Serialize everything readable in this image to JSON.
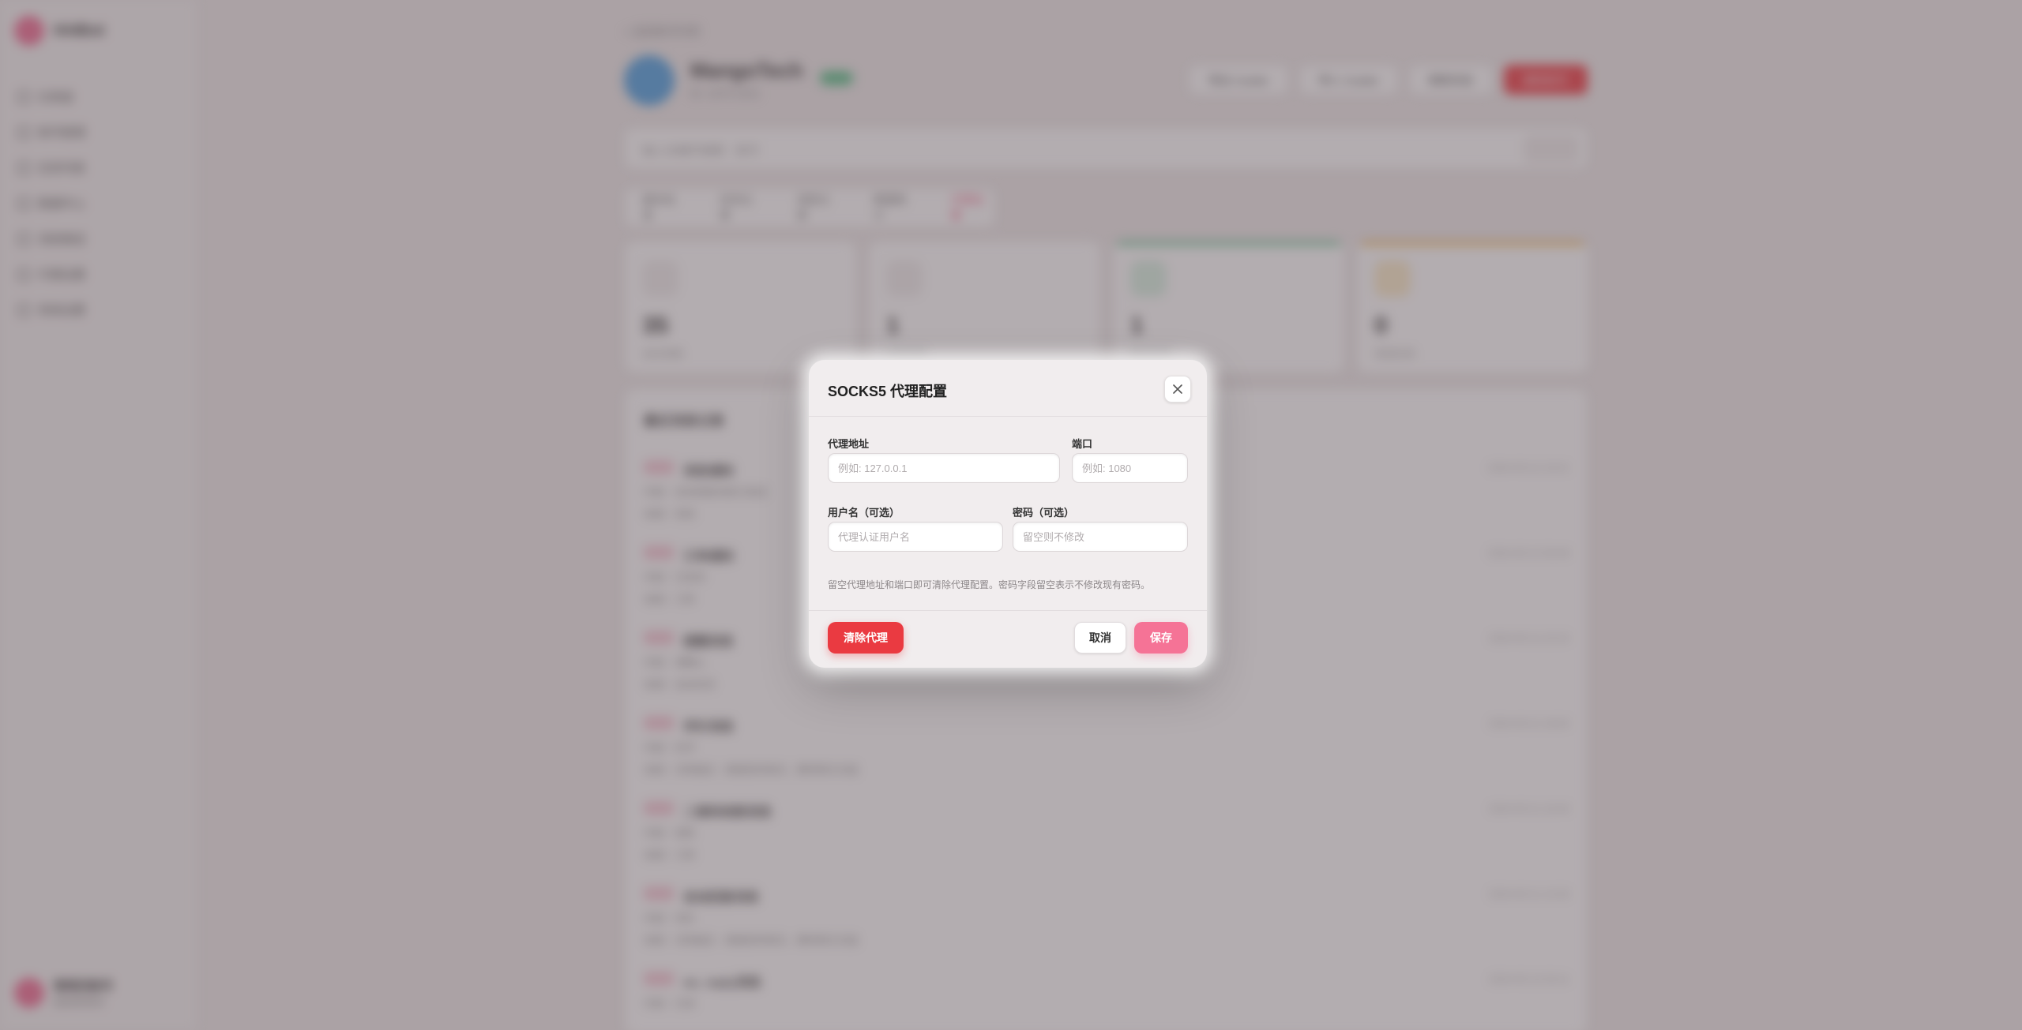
{
  "background": {
    "brand": "Hi4Bot",
    "nav": [
      "仪表盘",
      "账号管理",
      "任务列表",
      "数据中心",
      "消息推送",
      "代理设置",
      "系统设置"
    ],
    "user": {
      "name": "管理员账号",
      "role": "超级管理员"
    },
    "breadcrumb": "< 返回账号列表",
    "profile": {
      "name": "MangoTech",
      "subtitle": "ID: 1675 0241"
    },
    "header_buttons": [
      "导出 Cookie",
      "导入 Cookie",
      "刷新状态",
      "删除账号"
    ],
    "search": {
      "placeholder": "输入关键字搜索 · 账号",
      "button": "搜索"
    },
    "tabs": [
      "基本信息",
      "任务记录",
      "消息记录",
      "数据统计",
      "代理设置"
    ],
    "stats": [
      {
        "value": "35",
        "label": "总任务数"
      },
      {
        "value": "1",
        "label": "今日任务"
      },
      {
        "value": "1",
        "label": "成功任务"
      },
      {
        "value": "0",
        "label": "失败任务"
      }
    ],
    "list_title": "最近消息记录",
    "list": [
      {
        "tag": "已发",
        "name": "消息通知",
        "d1": "内容：自动回复消息已发送",
        "d2": "来源：系统",
        "time": "2024-05-12 10:21"
      },
      {
        "tag": "已发",
        "name": "订单通知",
        "d1": "内容：已发货",
        "d2": "来源：订单",
        "time": "2024-05-12 09:48"
      },
      {
        "tag": "已发",
        "name": "提醒消息",
        "d1": "内容：请确认",
        "d2": "来源：自动任务",
        "time": "2024-05-11 22:15"
      },
      {
        "tag": "已发",
        "name": "评价消息",
        "d1": "内容：好评",
        "d2": "来源：买家留言 · 感谢您的购买，期待再次光临",
        "time": "2024-05-11 18:02"
      },
      {
        "tag": "已发",
        "name": "二维码收款消息",
        "d1": "内容：收款",
        "d2": "来源：订单",
        "time": "2024-05-11 16:40"
      },
      {
        "tag": "已发",
        "name": "自动回复消息",
        "d1": "内容：你好",
        "d2": "来源：买家留言 · 感谢您的购买，期待再次光临",
        "time": "2024-05-11 12:33"
      },
      {
        "tag": "已发",
        "name": "no_reply消息",
        "d1": "内容：已读",
        "d2": "",
        "time": "2024-05-10 20:11"
      }
    ]
  },
  "colors": {
    "accent_pink": "#f57396",
    "danger_red": "#ea3a41",
    "overlay": "#60545a"
  },
  "modal": {
    "title": "SOCKS5 代理配置",
    "close_icon": "close-icon",
    "fields": {
      "address": {
        "label": "代理地址",
        "placeholder": "例如: 127.0.0.1",
        "value": ""
      },
      "port": {
        "label": "端口",
        "placeholder": "例如: 1080",
        "value": ""
      },
      "username": {
        "label": "用户名（可选）",
        "placeholder": "代理认证用户名",
        "value": ""
      },
      "password": {
        "label": "密码（可选）",
        "placeholder": "留空则不修改",
        "value": ""
      }
    },
    "hint": "留空代理地址和端口即可清除代理配置。密码字段留空表示不修改现有密码。",
    "buttons": {
      "clear": "清除代理",
      "cancel": "取消",
      "save": "保存"
    }
  }
}
